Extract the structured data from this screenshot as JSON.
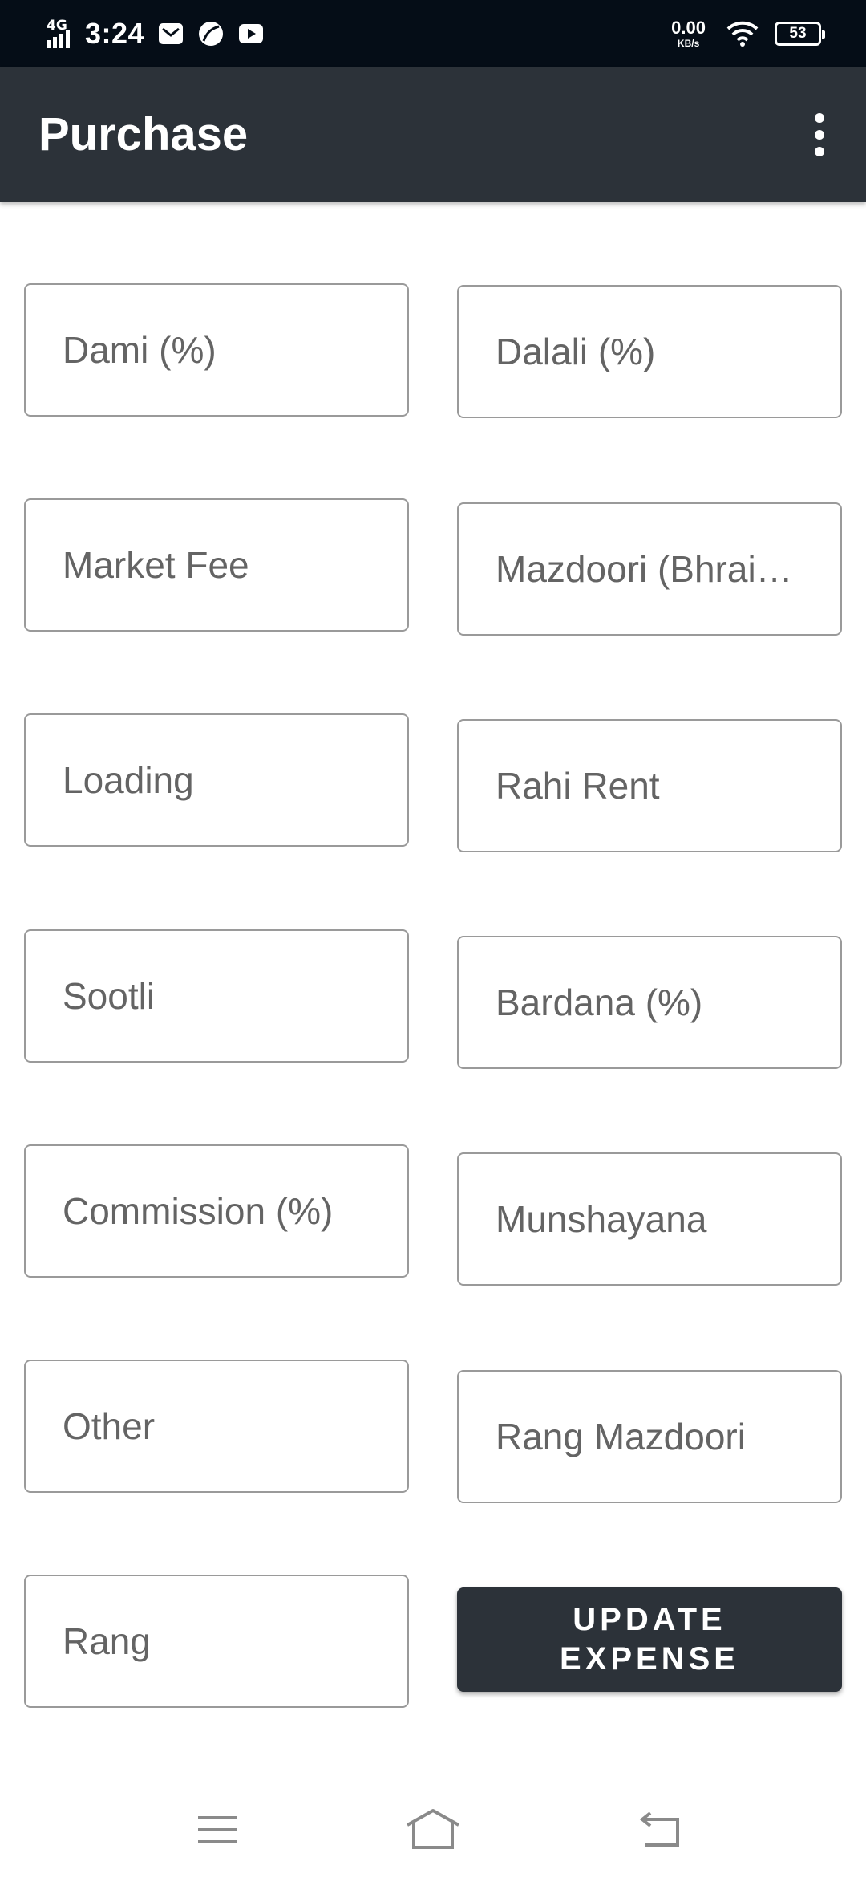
{
  "status_bar": {
    "network": "4G",
    "time": "3:24",
    "speed_value": "0.00",
    "speed_unit": "KB/s",
    "battery": "53",
    "notification_icons": [
      "mail-icon",
      "leaf-app-icon",
      "youtube-icon"
    ]
  },
  "app_bar": {
    "title": "Purchase",
    "menu_icon": "more-vertical-icon"
  },
  "form": {
    "fields": [
      {
        "name": "dami",
        "placeholder": "Dami (%)",
        "value": ""
      },
      {
        "name": "dalali",
        "placeholder": "Dalali (%)",
        "value": ""
      },
      {
        "name": "market-fee",
        "placeholder": "Market Fee",
        "value": ""
      },
      {
        "name": "mazdoori-bhrai",
        "placeholder": "Mazdoori (Bhrai…",
        "value": ""
      },
      {
        "name": "loading",
        "placeholder": "Loading",
        "value": ""
      },
      {
        "name": "rahi-rent",
        "placeholder": "Rahi Rent",
        "value": ""
      },
      {
        "name": "sootli",
        "placeholder": "Sootli",
        "value": ""
      },
      {
        "name": "bardana",
        "placeholder": "Bardana (%)",
        "value": ""
      },
      {
        "name": "commission",
        "placeholder": "Commission (%)",
        "value": ""
      },
      {
        "name": "munshayana",
        "placeholder": "Munshayana",
        "value": ""
      },
      {
        "name": "other",
        "placeholder": "Other",
        "value": ""
      },
      {
        "name": "rang-mazdoori",
        "placeholder": "Rang Mazdoori",
        "value": ""
      },
      {
        "name": "rang",
        "placeholder": "Rang",
        "value": ""
      }
    ],
    "update_button_label": "UPDATE EXPENSE"
  },
  "nav_bar": {
    "icons": [
      "menu-icon",
      "home-icon",
      "back-icon"
    ]
  },
  "colors": {
    "status_bar_bg": "#050d17",
    "app_bar_bg": "#2c3239",
    "button_bg": "#2c3239",
    "field_border": "#9a9a9a",
    "placeholder_text": "#646464"
  }
}
